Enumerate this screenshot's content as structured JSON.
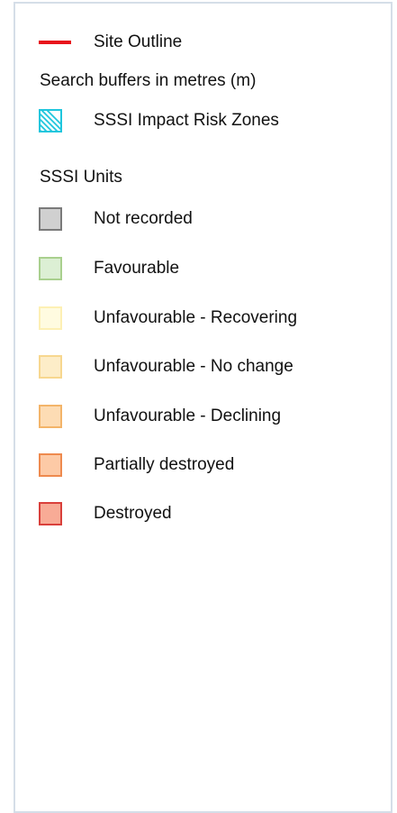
{
  "legend": {
    "site_outline": {
      "label": "Site Outline",
      "color": "#e8141c"
    },
    "search_buffers": {
      "label": "Search buffers in metres (m)"
    },
    "impact_zones": {
      "label": "SSSI Impact Risk Zones",
      "color": "#1fc6dd"
    },
    "units_heading": {
      "label": "SSSI Units"
    },
    "units": [
      {
        "label": "Not recorded",
        "fill": "#d0d0d0",
        "border": "#7a7a7a"
      },
      {
        "label": "Favourable",
        "fill": "#dcefd4",
        "border": "#a9d08e"
      },
      {
        "label": "Unfavourable - Recovering",
        "fill": "#fffbe0",
        "border": "#fdf0b4"
      },
      {
        "label": "Unfavourable - No change",
        "fill": "#fdedc8",
        "border": "#f7d78f"
      },
      {
        "label": "Unfavourable - Declining",
        "fill": "#fddcb4",
        "border": "#f3b469"
      },
      {
        "label": "Partially destroyed",
        "fill": "#fdcaa6",
        "border": "#ee8a4e"
      },
      {
        "label": "Destroyed",
        "fill": "#f8ab96",
        "border": "#d9403b"
      }
    ]
  }
}
